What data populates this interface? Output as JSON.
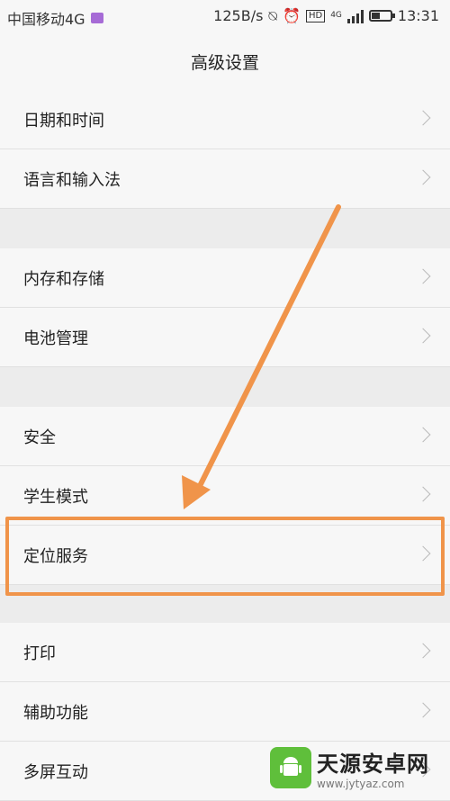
{
  "status_bar": {
    "carrier": "中国移动4G",
    "net_speed": "125B/s",
    "network_type": "4G",
    "hd": "HD",
    "time": "13:31",
    "battery_level": 0.45
  },
  "header": {
    "title": "高级设置"
  },
  "settings": {
    "items": [
      {
        "label": "日期和时间"
      },
      {
        "label": "语言和输入法"
      },
      {
        "label": "内存和存储"
      },
      {
        "label": "电池管理"
      },
      {
        "label": "安全"
      },
      {
        "label": "学生模式"
      },
      {
        "label": "定位服务"
      },
      {
        "label": "打印"
      },
      {
        "label": "辅助功能"
      },
      {
        "label": "多屏互动"
      }
    ]
  },
  "annotation": {
    "color": "#f0944a"
  },
  "watermark": {
    "title": "天源安卓网",
    "url": "www.jytyaz.com"
  }
}
